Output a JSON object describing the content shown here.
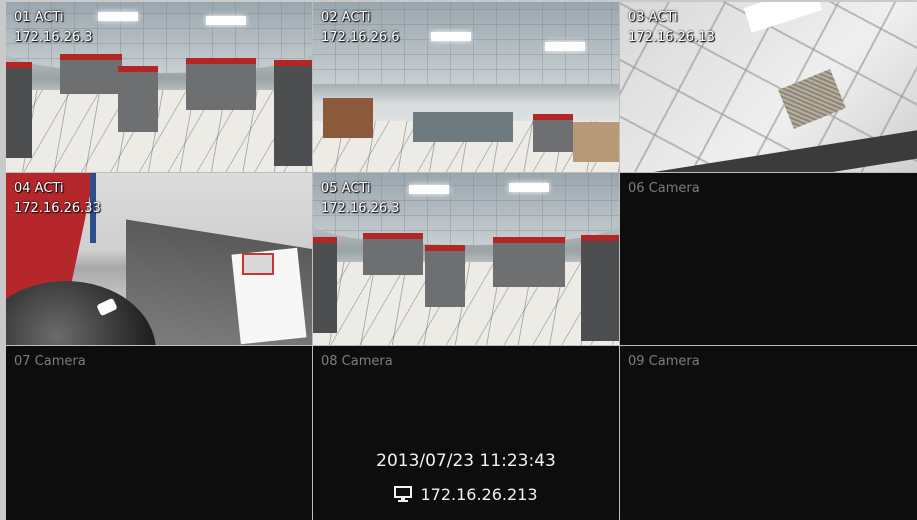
{
  "cameras": [
    {
      "name": "01 ACTi",
      "ip": "172.16.26.3"
    },
    {
      "name": "02 ACTi",
      "ip": "172.16.26.6"
    },
    {
      "name": "03 ACTi",
      "ip": "172.16.26.13"
    },
    {
      "name": "04 ACTi",
      "ip": "172.16.26.33"
    },
    {
      "name": "05 ACTi",
      "ip": "172.16.26.3",
      "selected": true
    },
    {
      "name": "06 Camera"
    },
    {
      "name": "07 Camera"
    },
    {
      "name": "08 Camera"
    },
    {
      "name": "09 Camera"
    }
  ],
  "status": {
    "datetime": "2013/07/23 11:23:43",
    "host_ip": "172.16.26.213",
    "host_icon": "monitor-icon"
  },
  "colors": {
    "selected_border": "#e38a1e",
    "empty_tile": "#0d0d0d",
    "empty_label": "#7d7d7d"
  }
}
